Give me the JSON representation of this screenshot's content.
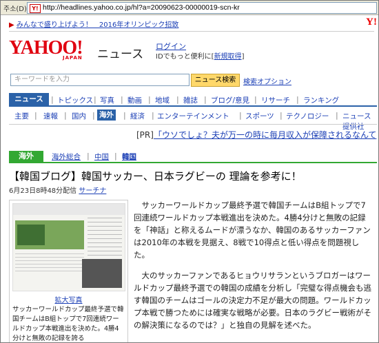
{
  "browser": {
    "address_label": "주소(D)",
    "url": "http://headlines.yahoo.co.jp/hl?a=20090623-00000019-scn-kr"
  },
  "promo": {
    "text": "みんなで盛り上げよう！　2016年オリンピック招致"
  },
  "header": {
    "logo_text": "YAHOO!",
    "logo_sub": "JAPAN",
    "title": "ニュース",
    "login": "ログイン",
    "id_text": "IDでもっと便利に",
    "register": "新規取得"
  },
  "search": {
    "placeholder": "キーワードを入力",
    "button": "ニュース検索",
    "options": "検索オプション"
  },
  "main_nav": [
    "ニュース",
    "トピックス",
    "写真",
    "動画",
    "地域",
    "雑誌",
    "ブログ/意見",
    "リサーチ",
    "ランキング"
  ],
  "sub_nav": [
    "主要",
    "速報",
    "国内",
    "海外",
    "経済",
    "エンターテインメント",
    "スポーツ",
    "テクノロジー",
    "ニュース提供社"
  ],
  "pr": {
    "label": "[PR]",
    "text": "「ウソでしょ？夫が万一の時に毎月収入が保障されるなんて"
  },
  "section": {
    "tag": "海外",
    "items": [
      "海外総合",
      "中国",
      "韓国"
    ]
  },
  "article": {
    "headline": "【韓国ブログ】韓国サッカー、日本ラグビーの 理論を参考に！",
    "date": "6月23日8時48分配信",
    "source": "サーチナ",
    "enlarge": "拡大写真",
    "caption": "サッカーワールドカップ最終予選で韓国チームはB組トップで7回連続ワールドカップ本戦進出を決めた。4勝4分けと無敗の記録を誇る",
    "paragraphs": [
      "サッカーワールドカップ最終予選で韓国チームはB組トップで7回連続ワールドカップ本戦進出を決めた。4勝4分けと無敗の記録を「神話」と称えるムードが漂うなか、韓国のあるサッカーファンは2010年の本戦を見据え、8戦で10得点と低い得点を問題視した。",
      "大のサッカーファンであるヒョウリサランというブロガーはワールドカップ最終予選での韓国の成績を分析し「完璧な得点機会も逃す韓国のチームはゴールの決定力不足が最大の問題。ワールドカップ本戦で勝つためには確実な戦略が必要。日本のラグビー戦術がその解決策になるのでは？」と独自の見解を述べた。"
    ]
  }
}
